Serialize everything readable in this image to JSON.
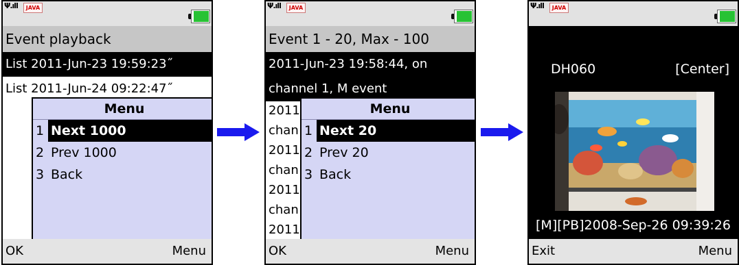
{
  "status": {
    "signal": "Ψ.ıll",
    "java_logo": "JAVA"
  },
  "screen1": {
    "title": "Event playback",
    "list": [
      "List 2011-Jun-23 19:59:23˝",
      "List 2011-Jun-24 09:22:47˝"
    ],
    "menu": {
      "header": "Menu",
      "items": [
        {
          "num": "1",
          "label": "Next 1000"
        },
        {
          "num": "2",
          "label": "Prev 1000"
        },
        {
          "num": "3",
          "label": "Back"
        }
      ]
    },
    "soft_left": "OK",
    "soft_right": "Menu"
  },
  "screen2": {
    "title": "Event 1 - 20, Max - 100",
    "selected_lines": [
      "2011-Jun-23 19:58:44, on",
      "channel 1, M event"
    ],
    "background_lines": [
      "2011",
      "chan",
      "2011",
      "chan",
      "2011",
      "chan",
      "2011"
    ],
    "menu": {
      "header": "Menu",
      "items": [
        {
          "num": "1",
          "label": "Next 20"
        },
        {
          "num": "2",
          "label": "Prev 20"
        },
        {
          "num": "3",
          "label": "Back"
        }
      ]
    },
    "soft_left": "OK",
    "soft_right": "Menu"
  },
  "screen3": {
    "camera_name": "DH060",
    "camera_position": "[Center]",
    "timestamp": "[M][PB]2008-Sep-26 09:39:26",
    "soft_left": "Exit",
    "soft_right": "Menu"
  },
  "colors": {
    "arrow": "#1a1aee",
    "menu_bg": "#d5d6f5",
    "battery": "#27c234"
  }
}
